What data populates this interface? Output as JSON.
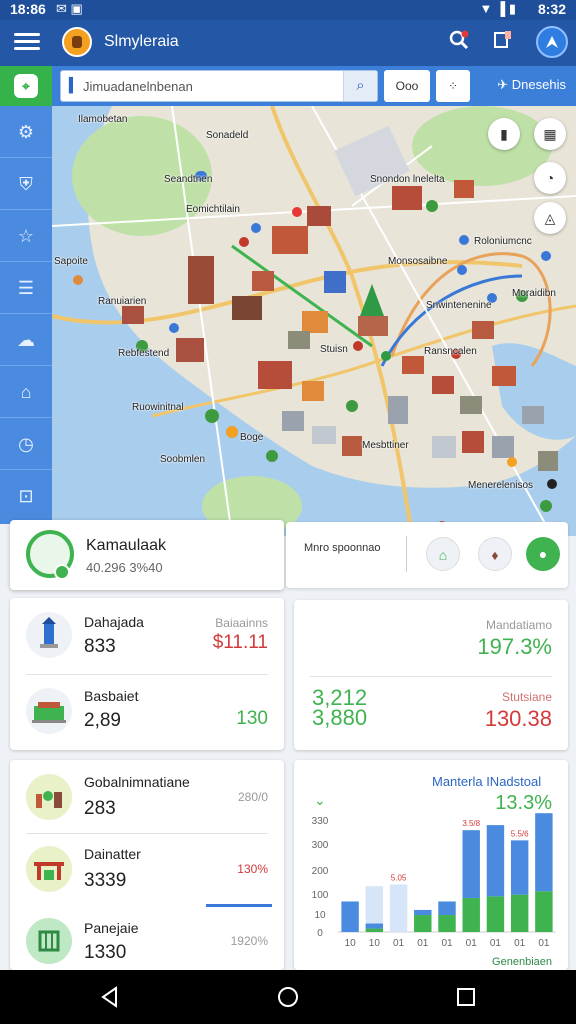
{
  "status_bar": {
    "time": "18:86",
    "right_time": "8:32"
  },
  "app_bar": {
    "title": "Slmyleraia",
    "menu_icon": "menu-icon",
    "search_icon": "search-icon",
    "edit_icon": "edit-icon",
    "avatar_icon": "navigation-icon"
  },
  "search": {
    "placeholder": "Jimuadanelnbenan",
    "button_1": "Ooo",
    "button_2": "⁘",
    "right_label": "Dnesehis"
  },
  "sidebar": {
    "items": [
      "gear-icon",
      "shield-icon",
      "star-icon",
      "list-icon",
      "chat-icon",
      "bag-icon",
      "clock-icon",
      "lock-icon"
    ]
  },
  "map": {
    "labels": [
      "Ilamobetan",
      "Sonadeld",
      "Seandtnen",
      "Eomichtilain",
      "Sapoite",
      "Snondon lnelelta",
      "Roloniumcnc",
      "Ranuiarien",
      "Monsosaibne",
      "Snwintenenine",
      "Rebfestend",
      "Moraidibn",
      "Stuisn",
      "Ransncalen",
      "Ruowinitnal",
      "Mesbttiner",
      "Boge",
      "Soobmlen",
      "Menerelenisos"
    ]
  },
  "place_card": {
    "name": "Kamaulaak",
    "coords": "40.296 3%40"
  },
  "info_card": {
    "label": "Mnro spoonnao"
  },
  "card_a": {
    "rows": [
      {
        "title": "Dahajada",
        "value": "833",
        "right_label": "Baiaainns",
        "right_value": "$11.11",
        "right_color": "#d33a3a"
      },
      {
        "title": "Basbaiet",
        "value": "2,89",
        "right_label": "",
        "right_value": "130",
        "right_color": "#3fb34f"
      }
    ]
  },
  "card_b": {
    "top_label": "Mandatiamo",
    "top_value": "197.3%",
    "top_color": "#3fb34f",
    "left_value_1": "3,212",
    "left_value_2": "3,880",
    "bottom_label": "Stutsiane",
    "bottom_value": "130.38",
    "bottom_color": "#d33a3a"
  },
  "card_c": {
    "rows": [
      {
        "title": "Gobalnimnatiane",
        "value": "283",
        "right_label": "280/0"
      },
      {
        "title": "Dainatter",
        "value": "3339",
        "right_label": "130%"
      },
      {
        "title": "Panejaie",
        "value": "1330",
        "right_label": "1920%"
      }
    ]
  },
  "chart_data": {
    "type": "bar",
    "title": "Manterla INadstoal",
    "headline_value": "13.3%",
    "footer_label": "Genenbiaen",
    "y_ticks": [
      "330",
      "300",
      "200",
      "100",
      "10",
      "0"
    ],
    "categories": [
      "10",
      "10",
      "01",
      "01",
      "01",
      "01",
      "01",
      "01",
      "01"
    ],
    "series": [
      {
        "color": "#3fb34f",
        "values": [
          0,
          10,
          0,
          50,
          50,
          100,
          105,
          110,
          120
        ]
      },
      {
        "color": "#4a8be0",
        "values": [
          90,
          15,
          0,
          15,
          40,
          200,
          210,
          160,
          230
        ]
      },
      {
        "color": "#d6e6f8",
        "values": [
          0,
          110,
          140,
          0,
          0,
          0,
          0,
          0,
          0
        ]
      }
    ],
    "data_labels": [
      "",
      "",
      "5.05",
      "",
      "",
      "3.5/8",
      "",
      "5.5/6",
      ""
    ]
  }
}
